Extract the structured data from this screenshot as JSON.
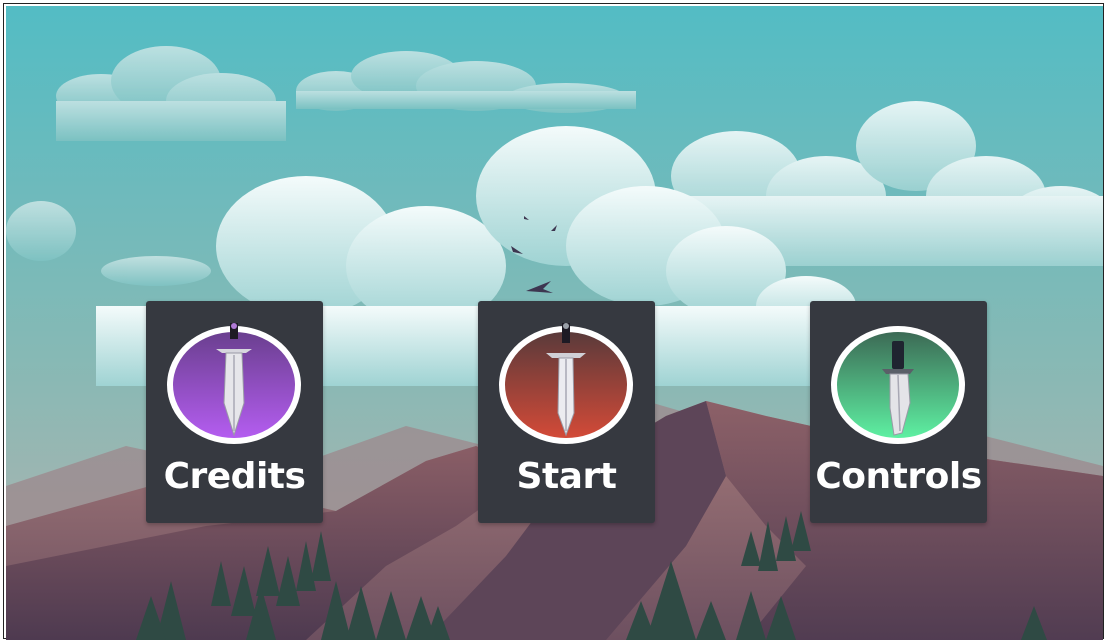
{
  "menu": {
    "credits": {
      "label": "Credits",
      "icon": "purple-sword-icon",
      "color_top": "#6a3f8f",
      "color_bottom": "#b45df0"
    },
    "start": {
      "label": "Start",
      "icon": "red-sword-icon",
      "color_top": "#5a3a3a",
      "color_bottom": "#d34a38"
    },
    "controls": {
      "label": "Controls",
      "icon": "green-dagger-icon",
      "color_top": "#3c6a55",
      "color_bottom": "#5ef0a2"
    }
  },
  "colors": {
    "sky_top": "#53bcc4",
    "sky_bottom": "#a9b7b3",
    "card_bg": "#363940",
    "mountain_main": "#6e4c5c",
    "mountain_light": "#a07176"
  }
}
